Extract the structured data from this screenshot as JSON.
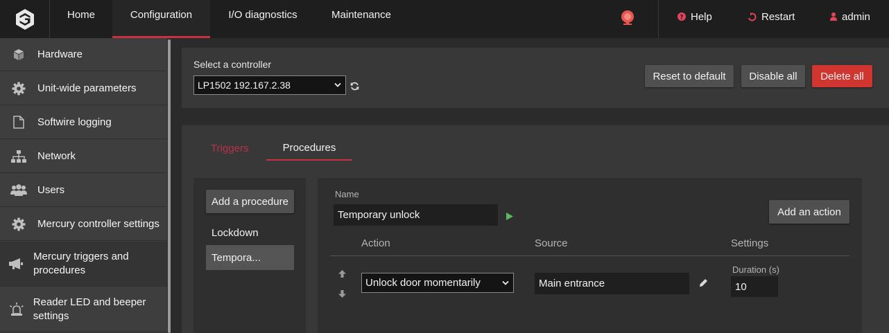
{
  "nav": {
    "items": [
      {
        "label": "Home"
      },
      {
        "label": "Configuration"
      },
      {
        "label": "I/O diagnostics"
      },
      {
        "label": "Maintenance"
      }
    ],
    "help": "Help",
    "restart": "Restart",
    "user": "admin"
  },
  "sidebar": {
    "items": [
      {
        "label": "Hardware",
        "icon": "cube-icon"
      },
      {
        "label": "Unit-wide parameters",
        "icon": "gear-icon"
      },
      {
        "label": "Softwire logging",
        "icon": "file-icon"
      },
      {
        "label": "Network",
        "icon": "network-icon"
      },
      {
        "label": "Users",
        "icon": "users-icon"
      },
      {
        "label": "Mercury controller settings",
        "icon": "gear-icon"
      },
      {
        "label": "Mercury triggers and procedures",
        "icon": "megaphone-icon"
      },
      {
        "label": "Reader LED and beeper settings",
        "icon": "beacon-icon"
      }
    ]
  },
  "controller": {
    "label": "Select a controller",
    "selected": "LP1502 192.167.2.38",
    "reset": "Reset to default",
    "disable": "Disable all",
    "delete": "Delete all"
  },
  "tabs": {
    "triggers": "Triggers",
    "procedures": "Procedures"
  },
  "procedures": {
    "add": "Add a procedure",
    "list": [
      "Lockdown",
      "Tempora..."
    ]
  },
  "editor": {
    "name_label": "Name",
    "name_value": "Temporary unlock",
    "add_action": "Add an action",
    "columns": {
      "action": "Action",
      "source": "Source",
      "settings": "Settings"
    },
    "row": {
      "action": "Unlock door momentarily",
      "source": "Main entrance",
      "duration_label": "Duration (s)",
      "duration_value": "10"
    }
  },
  "colors": {
    "accent": "#c8313f",
    "danger": "#d0352f",
    "play": "#5cb85c"
  }
}
